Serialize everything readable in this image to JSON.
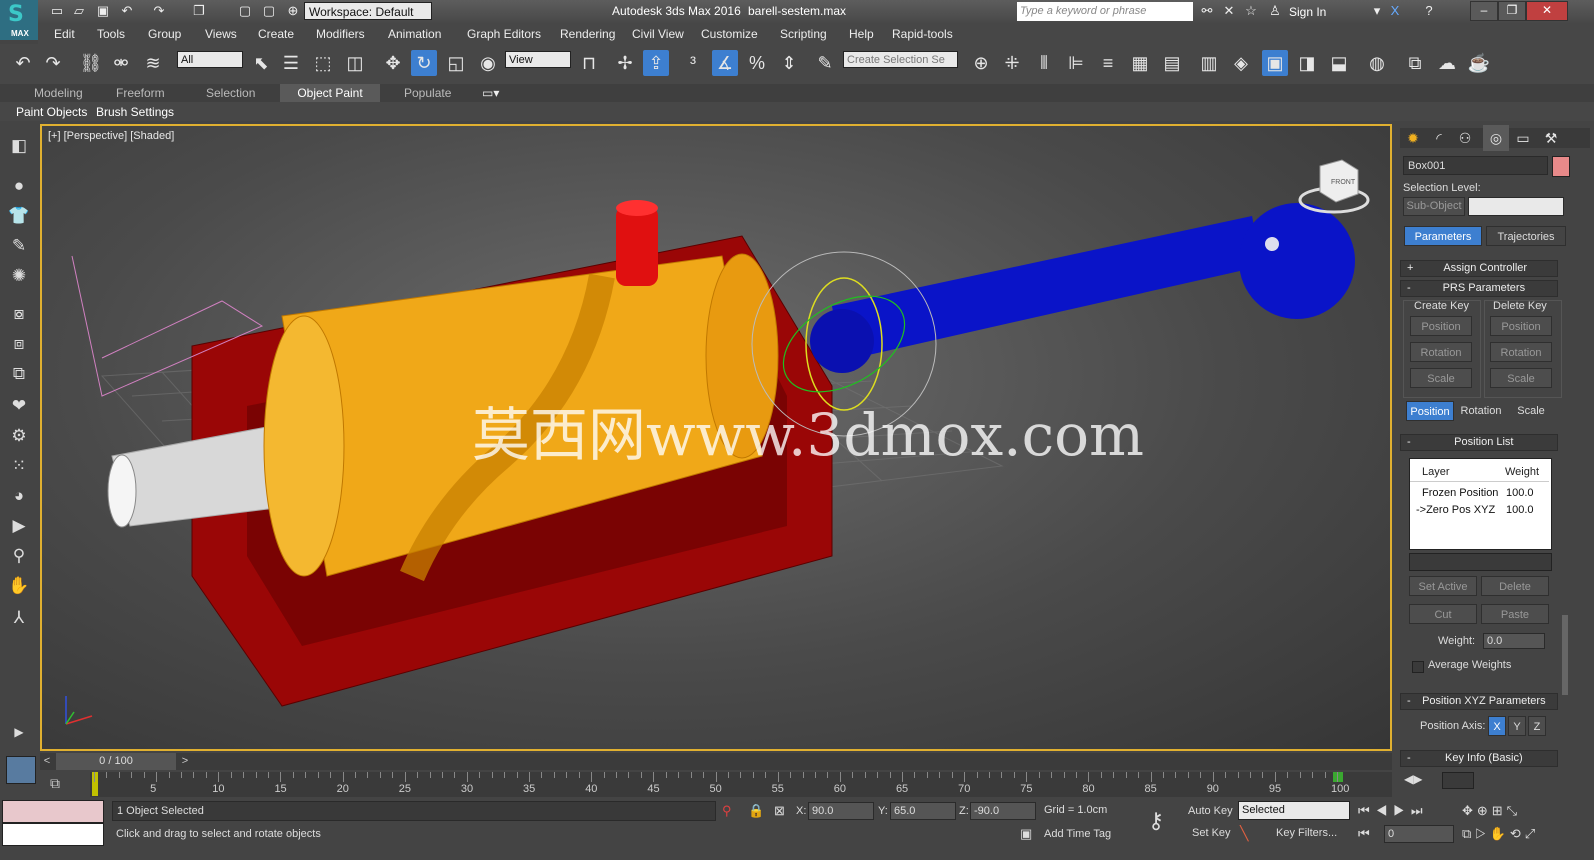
{
  "app": {
    "logo_text": "MAX",
    "title": "Autodesk 3ds Max 2016",
    "file": "barell-sestem.max",
    "workspace": "Workspace: Default",
    "search_placeholder": "Type a keyword or phrase",
    "sign_in": "Sign In"
  },
  "menu": [
    "Edit",
    "Tools",
    "Group",
    "Views",
    "Create",
    "Modifiers",
    "Animation",
    "Graph Editors",
    "Rendering",
    "Civil View",
    "Customize",
    "Scripting",
    "Help",
    "Rapid-tools"
  ],
  "toolbar": {
    "filter": "All",
    "ref_coord": "View",
    "selection_set": "Create Selection Se"
  },
  "ribbon": {
    "tabs": [
      "Modeling",
      "Freeform",
      "Selection",
      "Object Paint",
      "Populate"
    ],
    "active_tab": "Object Paint",
    "sub_items": [
      "Paint Objects",
      "Brush Settings"
    ]
  },
  "viewport": {
    "label": "[+] [Perspective] [Shaded]",
    "watermark": "莫西网www.3dmox.com",
    "viewcube_label": "FRONT"
  },
  "command_panel": {
    "object_name": "Box001",
    "object_color": "#e88a8a",
    "selection_level_label": "Selection Level:",
    "sub_object": "Sub-Object",
    "tabs": [
      "Parameters",
      "Trajectories"
    ],
    "active_tab": "Parameters",
    "assign_controller": "Assign Controller",
    "prs_parameters": "PRS Parameters",
    "create_key": "Create Key",
    "delete_key": "Delete Key",
    "create_buttons": [
      "Position",
      "Rotation",
      "Scale"
    ],
    "delete_buttons": [
      "Position",
      "Rotation",
      "Scale"
    ],
    "prs_mode_buttons": [
      "Position",
      "Rotation",
      "Scale"
    ],
    "position_list": "Position List",
    "list_headers": [
      "Layer",
      "Weight"
    ],
    "list_rows": [
      {
        "layer": "Frozen Position",
        "weight": "100.0"
      },
      {
        "layer": "->Zero Pos XYZ",
        "weight": "100.0"
      }
    ],
    "set_active": "Set Active",
    "delete": "Delete",
    "cut": "Cut",
    "paste": "Paste",
    "weight_label": "Weight:",
    "weight_value": "0.0",
    "average_weights": "Average Weights",
    "xyz_parameters": "Position XYZ Parameters",
    "position_axis_label": "Position Axis:",
    "axes": [
      "X",
      "Y",
      "Z"
    ],
    "active_axis": "X",
    "key_info": "Key Info (Basic)"
  },
  "timeline": {
    "frame_display": "0 / 100",
    "ticks": [
      "5",
      "10",
      "15",
      "20",
      "25",
      "30",
      "35",
      "40",
      "45",
      "50",
      "55",
      "60",
      "65",
      "70",
      "75",
      "80",
      "85",
      "90",
      "95",
      "100"
    ]
  },
  "status": {
    "selection": "1 Object Selected",
    "prompt": "Click and drag to select and rotate objects",
    "x_label": "X:",
    "x_value": "90.0",
    "y_label": "Y:",
    "y_value": "65.0",
    "z_label": "Z:",
    "z_value": "-90.0",
    "grid": "Grid = 1.0cm",
    "auto_key": "Auto Key",
    "set_key": "Set Key",
    "key_mode": "Selected",
    "key_filters": "Key Filters...",
    "add_time_tag": "Add Time Tag",
    "current_frame": "0"
  },
  "colors": {
    "accent": "#3d7fd0",
    "viewport_border": "#e0b030",
    "barrel": "#f0a818",
    "frame": "#a00808",
    "rod": "#0a14c8",
    "cylinder": "#e01010"
  }
}
